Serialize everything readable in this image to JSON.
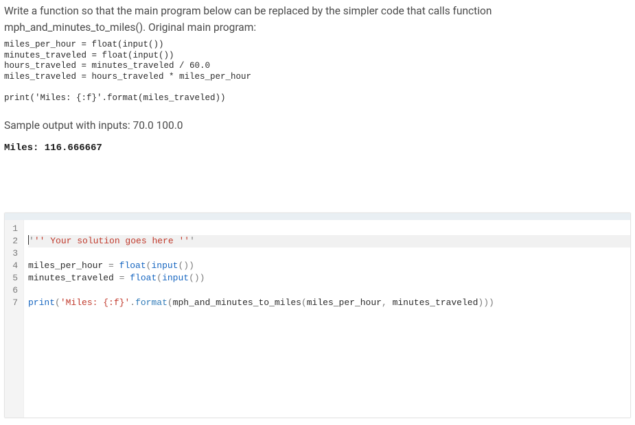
{
  "problem": {
    "text": "Write a function so that the main program below can be replaced by the simpler code that calls function mph_and_minutes_to_miles(). Original main program:"
  },
  "original_code": "miles_per_hour = float(input())\nminutes_traveled = float(input())\nhours_traveled = minutes_traveled / 60.0\nmiles_traveled = hours_traveled * miles_per_hour\n\nprint('Miles: {:f}'.format(miles_traveled))",
  "sample": {
    "label": "Sample output with inputs: 70.0 100.0",
    "output": "Miles: 116.666667"
  },
  "editor": {
    "active_line_index": 1,
    "lines": [
      {
        "num": 1,
        "segments": []
      },
      {
        "num": 2,
        "segments": [
          {
            "cls": "tok-op",
            "t": "'"
          },
          {
            "cls": "tok-str",
            "t": "'' Your solution goes here ''"
          },
          {
            "cls": "tok-op",
            "t": "'"
          }
        ],
        "cursor_before": true
      },
      {
        "num": 3,
        "segments": []
      },
      {
        "num": 4,
        "segments": [
          {
            "cls": "",
            "t": "miles_per_hour "
          },
          {
            "cls": "tok-op",
            "t": "= "
          },
          {
            "cls": "tok-kw",
            "t": "float"
          },
          {
            "cls": "tok-op",
            "t": "("
          },
          {
            "cls": "tok-kw",
            "t": "input"
          },
          {
            "cls": "tok-op",
            "t": "())"
          }
        ]
      },
      {
        "num": 5,
        "segments": [
          {
            "cls": "",
            "t": "minutes_traveled "
          },
          {
            "cls": "tok-op",
            "t": "= "
          },
          {
            "cls": "tok-kw",
            "t": "float"
          },
          {
            "cls": "tok-op",
            "t": "("
          },
          {
            "cls": "tok-kw",
            "t": "input"
          },
          {
            "cls": "tok-op",
            "t": "())"
          }
        ]
      },
      {
        "num": 6,
        "segments": []
      },
      {
        "num": 7,
        "segments": [
          {
            "cls": "tok-kw",
            "t": "print"
          },
          {
            "cls": "tok-op",
            "t": "("
          },
          {
            "cls": "tok-str",
            "t": "'Miles: {:f}'"
          },
          {
            "cls": "tok-op",
            "t": "."
          },
          {
            "cls": "tok-call",
            "t": "format"
          },
          {
            "cls": "tok-op",
            "t": "("
          },
          {
            "cls": "",
            "t": "mph_and_minutes_to_miles"
          },
          {
            "cls": "tok-op",
            "t": "("
          },
          {
            "cls": "",
            "t": "miles_per_hour"
          },
          {
            "cls": "tok-op",
            "t": ", "
          },
          {
            "cls": "",
            "t": "minutes_traveled"
          },
          {
            "cls": "tok-op",
            "t": ")))"
          }
        ]
      }
    ]
  }
}
